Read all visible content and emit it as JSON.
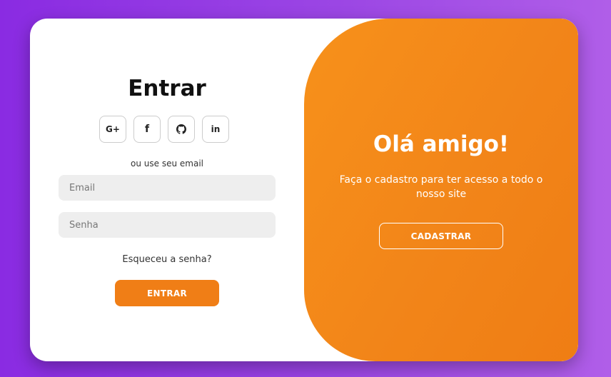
{
  "colors": {
    "background_gradient": [
      "#8a2be2",
      "#b05ee8"
    ],
    "accent": "#f07e16",
    "input_bg": "#eeeeee"
  },
  "login": {
    "title": "Entrar",
    "social_buttons": [
      {
        "label": "G+",
        "icon": "google-plus-icon"
      },
      {
        "label": "f",
        "icon": "facebook-icon"
      },
      {
        "label": "",
        "icon": "github-icon"
      },
      {
        "label": "in",
        "icon": "linkedin-icon"
      }
    ],
    "divider_text": "ou use seu email",
    "email_placeholder": "Email",
    "password_placeholder": "Senha",
    "forgot_link": "Esqueceu a senha?",
    "submit_label": "ENTRAR"
  },
  "signup_panel": {
    "title": "Olá amigo!",
    "text": "Faça o cadastro para ter acesso a todo o nosso site",
    "button_label": "CADASTRAR"
  }
}
